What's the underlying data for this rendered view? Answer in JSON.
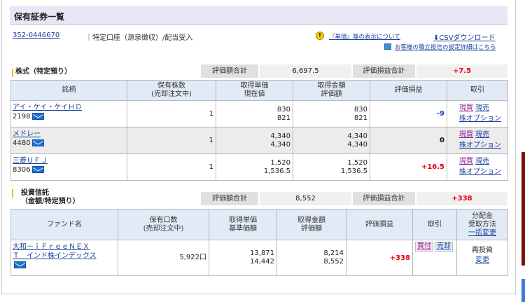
{
  "header": {
    "title": "保有証券一覧",
    "account_number": "352-0446670",
    "account_type": "特定口座（源泉徴収）/配当受入",
    "info_link": "『単価』等の表示について",
    "csv_link": "CSVダウンロード",
    "plan_link": "お客様の積立投信の設定詳細はこちら"
  },
  "stocks": {
    "section_title": "株式（特定預り）",
    "summary": {
      "value_label": "評価額合計",
      "value": "6,697.5",
      "pl_label": "評価損益合計",
      "pl": "+7.5"
    },
    "columns": {
      "name": "銘柄",
      "qty_1": "保有株数",
      "qty_2": "(売却注文中)",
      "price_1": "取得単価",
      "price_2": "現在値",
      "amount_1": "取得金額",
      "amount_2": "評価額",
      "pl": "評価損益",
      "trade": "取引"
    },
    "rows": [
      {
        "name": "アイ・ケイ・ケイＨＤ",
        "code": "2198",
        "qty": "1",
        "cost_price": "830",
        "current_price": "821",
        "cost_amount": "830",
        "value_amount": "821",
        "pl": "-9",
        "act_buy": "現買",
        "act_sell": "現売",
        "act_option": "株オプション"
      },
      {
        "name": "メドレー",
        "code": "4480",
        "qty": "1",
        "cost_price": "4,340",
        "current_price": "4,340",
        "cost_amount": "4,340",
        "value_amount": "4,340",
        "pl": "0",
        "act_buy": "現買",
        "act_sell": "現売",
        "act_option": "株オプション"
      },
      {
        "name": "三菱ＵＦＪ",
        "code": "8306",
        "qty": "1",
        "cost_price": "1,520",
        "current_price": "1,536.5",
        "cost_amount": "1,520",
        "value_amount": "1,536.5",
        "pl": "+16.5",
        "act_buy": "現買",
        "act_sell": "現売",
        "act_option": "株オプション"
      }
    ]
  },
  "funds": {
    "section_title_1": "投資信託",
    "section_title_2": "（金額/特定預り）",
    "summary": {
      "value_label": "評価額合計",
      "value": "8,552",
      "pl_label": "評価損益合計",
      "pl": "+338"
    },
    "columns": {
      "name": "ファンド名",
      "qty_1": "保有口数",
      "qty_2": "(売却注文中)",
      "price_1": "取得単価",
      "price_2": "基準価額",
      "amount_1": "取得金額",
      "amount_2": "評価額",
      "pl": "評価損益",
      "trade": "取引",
      "dist_1": "分配金",
      "dist_2": "受取方法",
      "dist_3": "一括変更"
    },
    "rows": [
      {
        "name_1": "大和－ｉＦｒｅｅＮＥＸ",
        "name_2": "Ｔ　インド株インデックス",
        "qty": "5,922口",
        "cost_price": "13,871",
        "base_price": "14,442",
        "cost_amount": "8,214",
        "value_amount": "8,552",
        "pl": "+338",
        "act_buy": "買付",
        "act_sell": "売却",
        "dist_method": "再投資",
        "dist_change": "変更"
      }
    ]
  }
}
